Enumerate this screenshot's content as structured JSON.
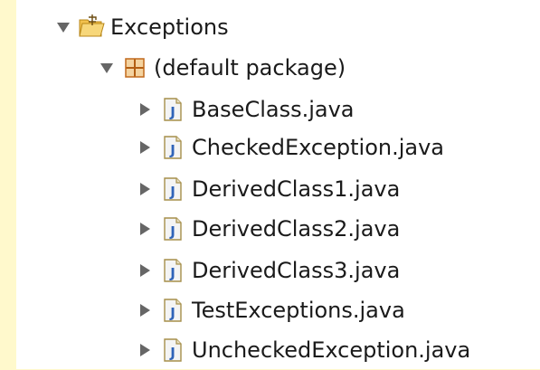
{
  "tree": {
    "project": {
      "label": "Exceptions",
      "icon": "project-folder-icon",
      "expanded": true
    },
    "package": {
      "label": "(default package)",
      "icon": "package-icon",
      "expanded": true
    },
    "files": [
      {
        "label": "BaseClass.java",
        "icon": "java-file-icon",
        "expanded": false
      },
      {
        "label": "CheckedException.java",
        "icon": "java-file-icon",
        "expanded": false
      },
      {
        "label": "DerivedClass1.java",
        "icon": "java-file-icon",
        "expanded": false
      },
      {
        "label": "DerivedClass2.java",
        "icon": "java-file-icon",
        "expanded": false
      },
      {
        "label": "DerivedClass3.java",
        "icon": "java-file-icon",
        "expanded": false
      },
      {
        "label": "TestExceptions.java",
        "icon": "java-file-icon",
        "expanded": false
      },
      {
        "label": "UncheckedException.java",
        "icon": "java-file-icon",
        "expanded": false
      }
    ]
  },
  "colors": {
    "background_outer": "#fff9cc",
    "panel": "#ffffff",
    "arrow": "#666666",
    "java_icon_blue": "#2f63b8",
    "package_orange": "#d9822b",
    "folder_yellow": "#f2c14e"
  }
}
